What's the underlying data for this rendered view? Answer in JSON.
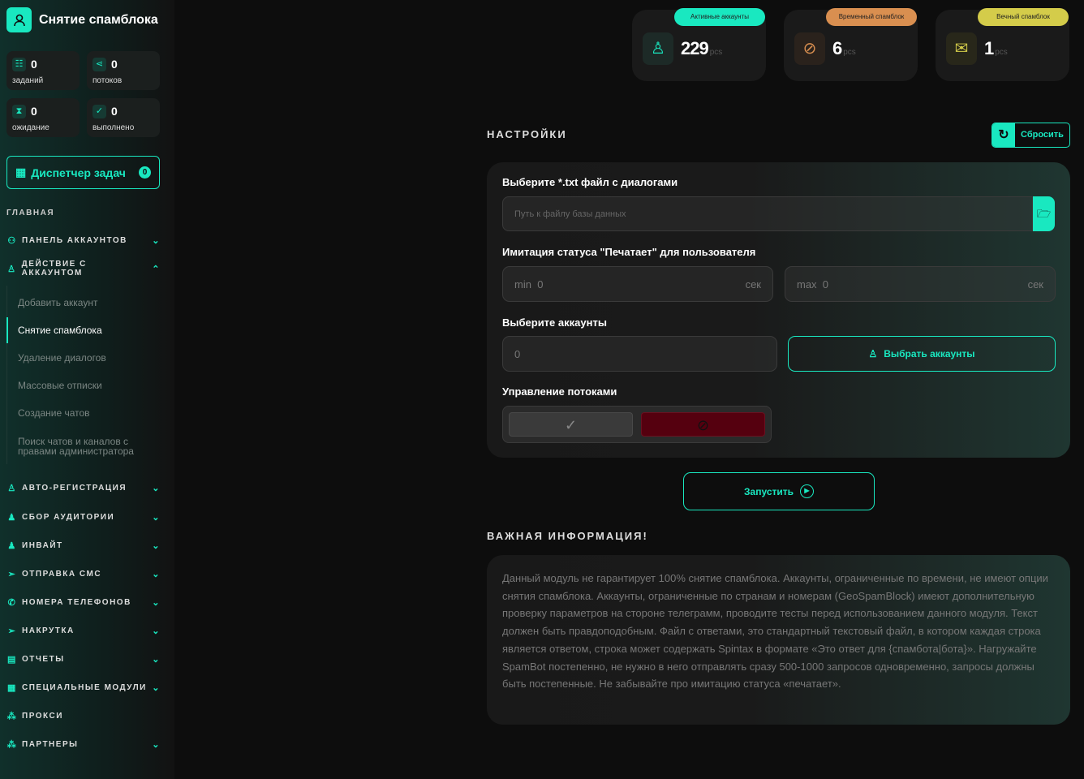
{
  "brand": {
    "title": "Снятие спамблока"
  },
  "stats": [
    {
      "value": "0",
      "label": "заданий"
    },
    {
      "value": "0",
      "label": "потоков"
    },
    {
      "value": "0",
      "label": "ожидание"
    },
    {
      "value": "0",
      "label": "выполнено"
    }
  ],
  "dispatcher": {
    "label": "Диспетчер задач",
    "count": "0"
  },
  "nav": {
    "section": "ГЛАВНАЯ",
    "items": [
      {
        "label": "ПАНЕЛЬ АККАУНТОВ"
      },
      {
        "label": "ДЕЙСТВИЕ С АККАУНТОМ"
      },
      {
        "label": "АВТО-РЕГИСТРАЦИЯ"
      },
      {
        "label": "СБОР АУДИТОРИИ"
      },
      {
        "label": "ИНВАЙТ"
      },
      {
        "label": "ОТПРАВКА СМС"
      },
      {
        "label": "НОМЕРА ТЕЛЕФОНОВ"
      },
      {
        "label": "НАКРУТКА"
      },
      {
        "label": "ОТЧЕТЫ"
      },
      {
        "label": "СПЕЦИАЛЬНЫЕ МОДУЛИ"
      },
      {
        "label": "ПРОКСИ"
      },
      {
        "label": "ПАРТНЕРЫ"
      }
    ],
    "sub": [
      "Добавить аккаунт",
      "Снятие спамблока",
      "Удаление диалогов",
      "Массовые отписки",
      "Создание чатов",
      "Поиск чатов и каналов с правами администратора"
    ]
  },
  "cards": [
    {
      "tag": "Активные аккаунты",
      "value": "229",
      "unit": "pcs",
      "color": "#19e8c0"
    },
    {
      "tag": "Временный спамблок",
      "value": "6",
      "unit": "pcs",
      "color": "#d98f50"
    },
    {
      "tag": "Вечный спамблок",
      "value": "1",
      "unit": "pcs",
      "color": "#d4cc4a"
    }
  ],
  "settings": {
    "title": "НАСТРОЙКИ",
    "reset": "Сбросить",
    "file_label": "Выберите *.txt файл с диалогами",
    "file_placeholder": "Путь к файлу базы данных",
    "typing_label": "Имитация статуса \"Печатает\" для пользователя",
    "min_prefix": "min",
    "min_value": "0",
    "max_prefix": "max",
    "max_value": "0",
    "unit": "сек",
    "accounts_label": "Выберите аккаунты",
    "accounts_value": "0",
    "select_accounts": "Выбрать аккаунты",
    "threads_label": "Управление потоками"
  },
  "run": "Запустить",
  "info": {
    "title": "ВАЖНАЯ ИНФОРМАЦИЯ!",
    "text": "Данный модуль не гарантирует 100% снятие спамблока. Аккаунты, ограниченные по времени, не имеют опции снятия спамблока. Аккаунты, ограниченные по странам и номерам (GeoSpamBlock) имеют дополнительную проверку параметров на стороне телеграмм, проводите тесты перед использованием данного модуля. Текст должен быть правдоподобным. Файл с ответами, это стандартный текстовый файл, в котором каждая строка является ответом, строка может содержать Spintax в формате «Это ответ для {спамбота|бота}». Нагружайте SpamBot постепенно, не нужно в него отправлять сразу 500-1000 запросов одновременно, запросы должны быть постепенные. Не забывайте про имитацию статуса «печатает»."
  }
}
